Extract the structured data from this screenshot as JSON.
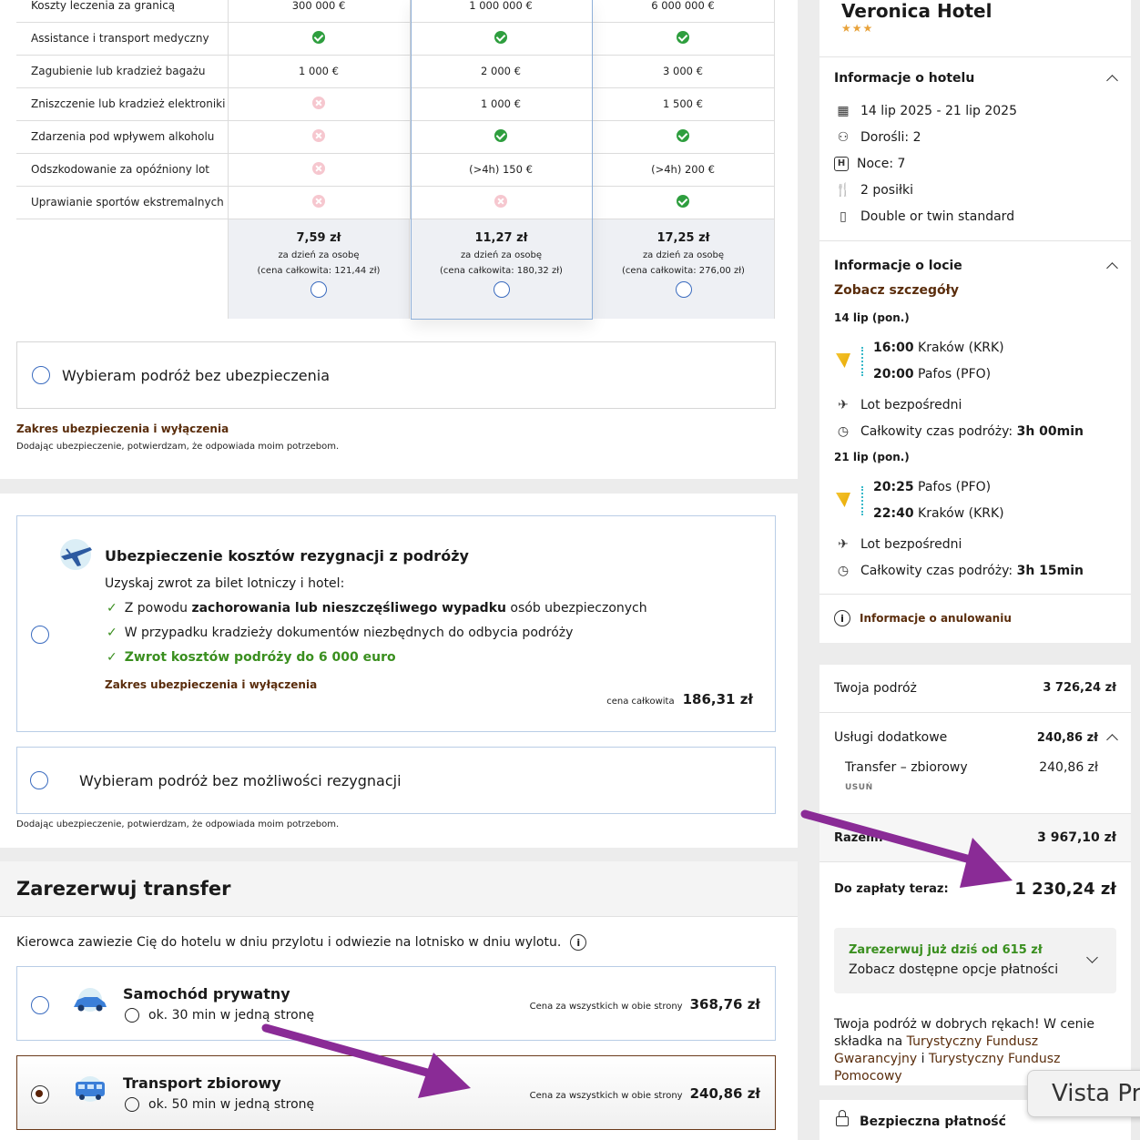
{
  "coverage": {
    "rows": [
      {
        "label": "Koszty leczenia za granicą",
        "values": [
          "300 000 €",
          "1 000 000 €",
          "6 000 000 €"
        ]
      },
      {
        "label": "Assistance i transport medyczny",
        "values": [
          "check",
          "check",
          "check"
        ]
      },
      {
        "label": "Zagubienie lub kradzież bagażu",
        "values": [
          "1 000 €",
          "2 000 €",
          "3 000 €"
        ]
      },
      {
        "label": "Zniszczenie lub kradzież elektroniki",
        "values": [
          "x",
          "1 000 €",
          "1 500 €"
        ]
      },
      {
        "label": "Zdarzenia pod wpływem alkoholu",
        "values": [
          "x",
          "check",
          "check"
        ]
      },
      {
        "label": "Odszkodowanie za opóźniony lot",
        "values": [
          "x",
          "(>4h) 150 €",
          "(>4h) 200 €"
        ]
      },
      {
        "label": "Uprawianie sportów ekstremalnych",
        "values": [
          "x",
          "x",
          "check"
        ]
      }
    ],
    "plans": [
      {
        "price": "7,59 zł",
        "per": "za dzień za osobę",
        "total": "(cena całkowita: 121,44 zł)"
      },
      {
        "price": "11,27 zł",
        "per": "za dzień za osobę",
        "total": "(cena całkowita: 180,32 zł)"
      },
      {
        "price": "17,25 zł",
        "per": "za dzień za osobę",
        "total": "(cena całkowita: 276,00 zł)"
      }
    ],
    "no_insurance": "Wybieram podróż bez ubezpieczenia",
    "scope_link": "Zakres ubezpieczenia i wyłączenia",
    "consent": "Dodając ubezpieczenie, potwierdzam, że odpowiada moim potrzebom."
  },
  "cancellation": {
    "title": "Ubezpieczenie kosztów rezygnacji z podróży",
    "subtitle": "Uzyskaj zwrot za bilet lotniczy i hotel:",
    "b1_prefix": "Z powodu ",
    "b1_bold": "zachorowania lub nieszczęśliwego wypadku",
    "b1_suffix": " osób ubezpieczonych",
    "b2": "W przypadku kradzieży dokumentów niezbędnych do odbycia podróży",
    "b3": "Zwrot kosztów podróży do 6 000 euro",
    "scope_link": "Zakres ubezpieczenia i wyłączenia",
    "price_label": "cena całkowita",
    "price": "186,31 zł",
    "no_option": "Wybieram podróż bez możliwości rezygnacji",
    "consent": "Dodając ubezpieczenie, potwierdzam, że odpowiada moim potrzebom."
  },
  "transfer": {
    "heading": "Zarezerwuj transfer",
    "desc": "Kierowca zawiezie Cię do hotelu w dniu przylotu i odwiezie na lotnisko w dniu wylotu.",
    "options": [
      {
        "name": "Samochód prywatny",
        "time": "ok. 30 min w jedną stronę",
        "price_label": "Cena za wszystkich w obie strony",
        "price": "368,76 zł",
        "selected": false
      },
      {
        "name": "Transport zbiorowy",
        "time": "ok. 50 min w jedną stronę",
        "price_label": "Cena za wszystkich w obie strony",
        "price": "240,86 zł",
        "selected": true
      }
    ]
  },
  "sidebar": {
    "hotel_name": "Veronica Hotel",
    "stars": "★★★",
    "hotel_info_title": "Informacje o hotelu",
    "dates": "14 lip 2025 - 21 lip 2025",
    "adults": "Dorośli: 2",
    "nights": "Noce: 7",
    "meals": "2 posiłki",
    "room": "Double or twin standard",
    "location_title": "Informacje o locie",
    "details_link": "Zobacz szczegóły",
    "out_date": "14 lip (pon.)",
    "out_dep_time": "16:00",
    "out_dep_place": "Kraków (KRK)",
    "out_arr_time": "20:00",
    "out_arr_place": "Pafos (PFO)",
    "out_direct": "Lot bezpośredni",
    "out_total_prefix": "Całkowity czas podróży: ",
    "out_total": "3h 00min",
    "ret_date": "21 lip (pon.)",
    "ret_dep_time": "20:25",
    "ret_dep_place": "Pafos (PFO)",
    "ret_arr_time": "22:40",
    "ret_arr_place": "Kraków (KRK)",
    "ret_direct": "Lot bezpośredni",
    "ret_total_prefix": "Całkowity czas podróży: ",
    "ret_total": "3h 15min",
    "cancel_info": "Informacje o anulowaniu",
    "trip_label": "Twoja podróż",
    "trip_value": "3 726,24 zł",
    "extras_label": "Usługi dodatkowe",
    "extras_value": "240,86 zł",
    "transfer_label": "Transfer – zbiorowy",
    "transfer_value": "240,86 zł",
    "remove": "USUŃ",
    "total_label": "Razem:",
    "total_value": "3 967,10 zł",
    "pay_now_label": "Do zapłaty teraz:",
    "pay_now_value": "1 230,24 zł",
    "reserve_from": "Zarezerwuj już dziś od 615 zł",
    "payment_options": "Zobacz dostępne opcje płatności",
    "trust_text": "Twoja podróż w dobrych rękach! W cenie składka na ",
    "trust_link1": "Turystyczny Fundusz Gwarancyjny",
    "trust_and": " i ",
    "trust_link2": "Turystyczny Fundusz Pomocowy",
    "secure": "Bezpieczna płatność",
    "vista": "Vista Pr"
  },
  "colors": {
    "accent_brown": "#5a2d0c",
    "green": "#3a8f1f",
    "arrow": "#8a2b96",
    "radio_blue": "#3a6bbf"
  }
}
